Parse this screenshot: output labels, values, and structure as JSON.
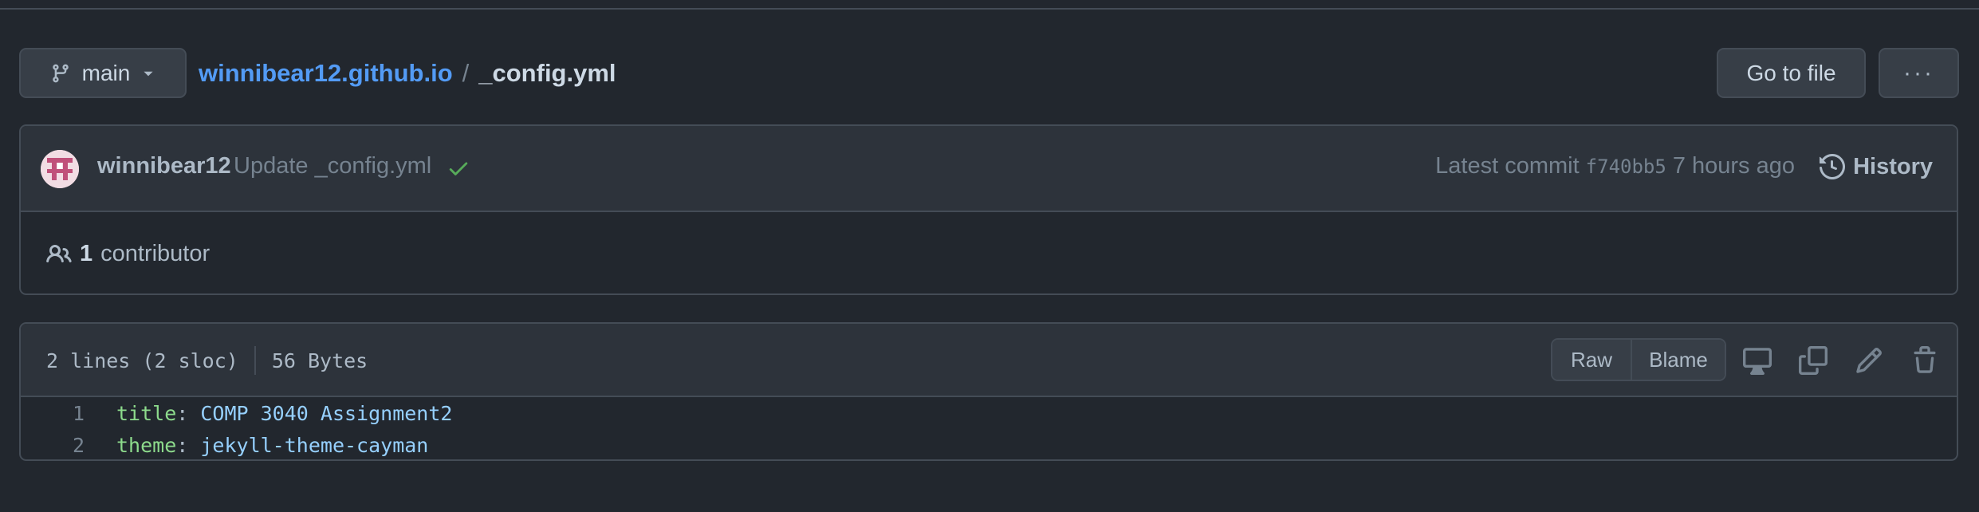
{
  "branch": {
    "label": "main"
  },
  "breadcrumb": {
    "repo": "winnibear12.github.io",
    "separator": "/",
    "file": "_config.yml"
  },
  "actions": {
    "go_to_file": "Go to file",
    "more": "···"
  },
  "commit": {
    "author": "winnibear12",
    "message": "Update _config.yml",
    "status": "success",
    "latest_label": "Latest commit",
    "sha": "f740bb5",
    "time": "7 hours ago",
    "history_label": "History"
  },
  "contributors": {
    "count": "1",
    "label": "contributor"
  },
  "file": {
    "lines_info": "2 lines (2 sloc)",
    "size": "56 Bytes",
    "raw_label": "Raw",
    "blame_label": "Blame",
    "lines": [
      {
        "number": "1",
        "key": "title",
        "value": "COMP 3040 Assignment2"
      },
      {
        "number": "2",
        "key": "theme",
        "value": "jekyll-theme-cayman"
      }
    ]
  },
  "colors": {
    "background": "#22272e",
    "panel": "#2d333b",
    "border": "#444c56",
    "link": "#539bf5",
    "success": "#57ab5a",
    "yaml_key": "#8ddb8c",
    "yaml_value": "#96d0ff"
  },
  "icons": [
    "git-branch-icon",
    "caret-down-icon",
    "check-icon",
    "history-icon",
    "people-icon",
    "display-icon",
    "copy-icon",
    "pencil-icon",
    "trash-icon"
  ]
}
